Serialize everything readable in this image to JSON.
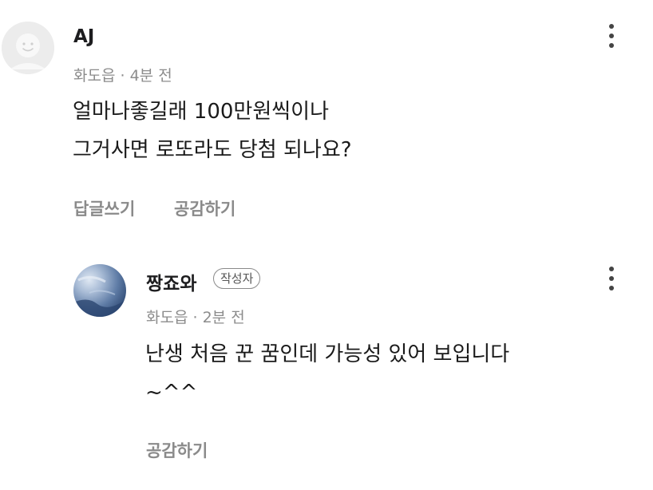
{
  "comments": [
    {
      "username": "AJ",
      "location": "화도읍",
      "separator": "·",
      "time": "4분 전",
      "body_lines": [
        "얼마나좋길래 100만원씩이나",
        "그거사면 로또라도 당첨 되나요?"
      ],
      "actions": {
        "reply": "답글쓰기",
        "like": "공감하기"
      },
      "avatar_icon": "default-avatar-icon",
      "more_icon": "more-vertical-icon"
    }
  ],
  "reply": {
    "username": "짱죠와",
    "author_badge": "작성자",
    "location": "화도읍",
    "separator": "·",
    "time": "2분 전",
    "body_lines": [
      "난생 처음 꾼 꿈인데 가능성 있어 보입니다",
      "~^^"
    ],
    "actions": {
      "like": "공감하기"
    },
    "avatar_icon": "photo-avatar",
    "more_icon": "more-vertical-icon"
  },
  "colors": {
    "text": "#1a1a1a",
    "muted": "#8c8c8c",
    "action": "#8a8a8a",
    "avatar_default_bg": "#ececec"
  }
}
